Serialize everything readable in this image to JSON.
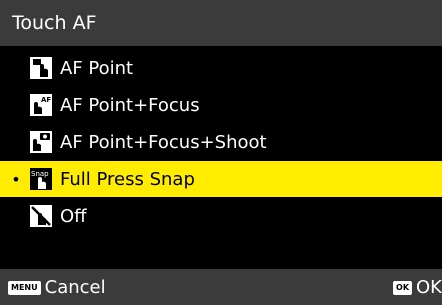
{
  "title": "Touch AF",
  "items": [
    {
      "label": "AF Point",
      "icon": "touch-af-point-icon",
      "selected": false
    },
    {
      "label": "AF Point+Focus",
      "icon": "touch-af-focus-icon",
      "selected": false
    },
    {
      "label": "AF Point+Focus+Shoot",
      "icon": "touch-af-shoot-icon",
      "selected": false
    },
    {
      "label": "Full Press Snap",
      "icon": "full-press-snap-icon",
      "selected": true,
      "icon_text": "Snap"
    },
    {
      "label": "Off",
      "icon": "touch-off-icon",
      "selected": false
    }
  ],
  "selected_marker": "•",
  "footer": {
    "cancel_key": "MENU",
    "cancel_label": "Cancel",
    "ok_key": "OK",
    "ok_label": "OK"
  },
  "colors": {
    "selected_bg": "#ffec00",
    "bar_bg": "#3b3b3b",
    "background": "#000000"
  }
}
